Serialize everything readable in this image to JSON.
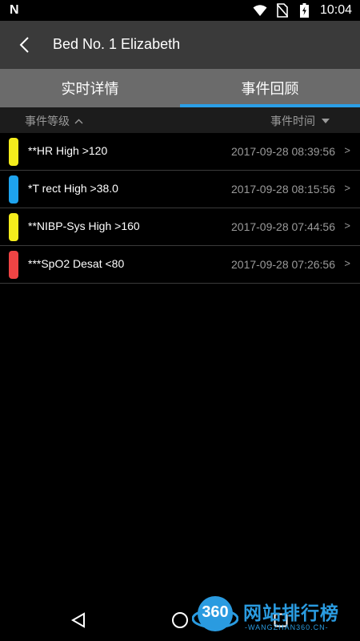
{
  "status_bar": {
    "notification_icon": "N",
    "time": "10:04",
    "icons": [
      "wifi-icon",
      "no-sim-icon",
      "battery-charging-icon"
    ]
  },
  "header": {
    "title": "Bed No. 1 Elizabeth"
  },
  "tabs": [
    {
      "label": "实时详情",
      "active": false
    },
    {
      "label": "事件回顾",
      "active": true
    }
  ],
  "sort": {
    "level_label": "事件等级",
    "time_label": "事件时间"
  },
  "events": [
    {
      "label": "**HR High >120",
      "time": "2017-09-28 08:39:56",
      "color": "#f4ec1c",
      "chevron": ">"
    },
    {
      "label": "*T rect High >38.0",
      "time": "2017-09-28 08:15:56",
      "color": "#1ea3ee",
      "chevron": ">"
    },
    {
      "label": "**NIBP-Sys High >160",
      "time": "2017-09-28 07:44:56",
      "color": "#f4ec1c",
      "chevron": ">"
    },
    {
      "label": "***SpO2 Desat <80",
      "time": "2017-09-28 07:26:56",
      "color": "#ef4444",
      "chevron": ">"
    }
  ],
  "colors": {
    "accent": "#2b9fe6",
    "header_bg": "#3a3a3a",
    "tabs_bg": "#6b6b6b"
  },
  "watermark": {
    "logo_text": "360",
    "name": "网站排行榜",
    "url": "-WANGZHAN360.CN-"
  }
}
